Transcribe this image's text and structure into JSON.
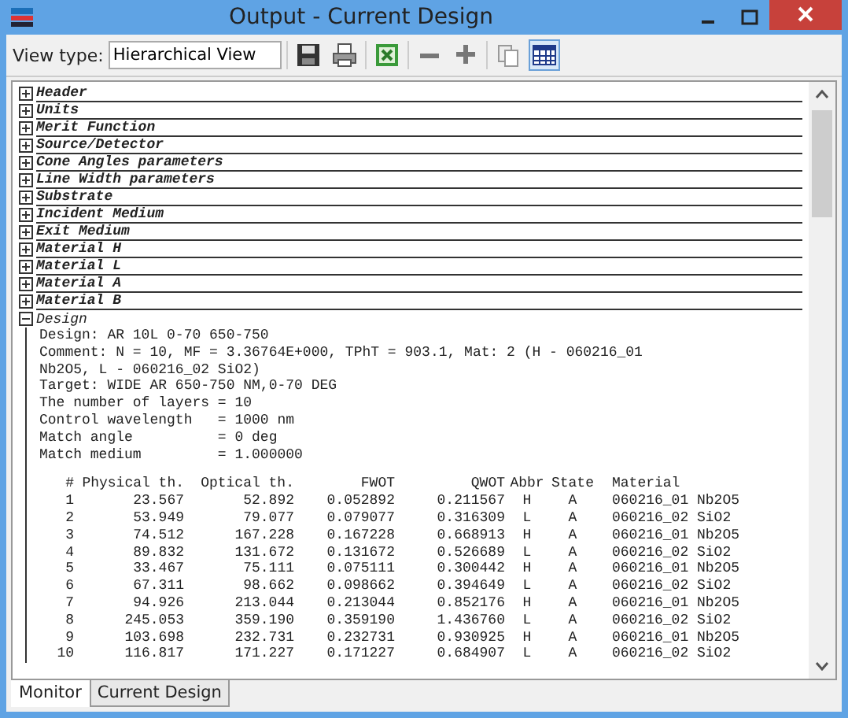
{
  "window": {
    "title": "Output - Current Design"
  },
  "toolbar": {
    "label": "View type:",
    "view_type": {
      "value": "Hierarchical View"
    },
    "buttons": [
      {
        "kind": "save",
        "selected": false
      },
      {
        "kind": "print",
        "selected": false
      },
      {
        "kind": "excel",
        "selected": false
      },
      {
        "kind": "collapse",
        "selected": false
      },
      {
        "kind": "expand",
        "selected": false
      },
      {
        "kind": "copy",
        "selected": false
      },
      {
        "kind": "table",
        "selected": true
      }
    ]
  },
  "tree": [
    {
      "label": "Header",
      "expanded": false
    },
    {
      "label": "Units",
      "expanded": false
    },
    {
      "label": "Merit Function",
      "expanded": false
    },
    {
      "label": "Source/Detector",
      "expanded": false
    },
    {
      "label": "Cone Angles parameters",
      "expanded": false
    },
    {
      "label": "Line Width parameters",
      "expanded": false
    },
    {
      "label": "Substrate",
      "expanded": false
    },
    {
      "label": "Incident Medium",
      "expanded": false
    },
    {
      "label": "Exit Medium",
      "expanded": false
    },
    {
      "label": "Material H",
      "expanded": false
    },
    {
      "label": "Material L",
      "expanded": false
    },
    {
      "label": "Material A",
      "expanded": false
    },
    {
      "label": "Material B",
      "expanded": false
    },
    {
      "label": "Design",
      "expanded": true,
      "lines": [
        "Design: AR 10L 0-70 650-750",
        "Comment: N = 10, MF = 3.36764E+000, TPhT = 903.1, Mat: 2 (H - 060216_01",
        "Nb2O5, L - 060216_02 SiO2)",
        "Target: WIDE AR 650-750 NM,0-70 DEG",
        "The number of layers = 10",
        "Control wavelength   = 1000 nm",
        "Match angle          = 0 deg",
        "Match medium         = 1.000000"
      ],
      "table": {
        "columns": [
          "#",
          "Physical th.",
          "Optical th.",
          "FWOT",
          "QWOT",
          "Abbr",
          "State",
          "Material"
        ],
        "rows": [
          [
            "1",
            "23.567",
            "52.892",
            "0.052892",
            "0.211567",
            "H",
            "A",
            "060216_01 Nb2O5"
          ],
          [
            "2",
            "53.949",
            "79.077",
            "0.079077",
            "0.316309",
            "L",
            "A",
            "060216_02 SiO2"
          ],
          [
            "3",
            "74.512",
            "167.228",
            "0.167228",
            "0.668913",
            "H",
            "A",
            "060216_01 Nb2O5"
          ],
          [
            "4",
            "89.832",
            "131.672",
            "0.131672",
            "0.526689",
            "L",
            "A",
            "060216_02 SiO2"
          ],
          [
            "5",
            "33.467",
            "75.111",
            "0.075111",
            "0.300442",
            "H",
            "A",
            "060216_01 Nb2O5"
          ],
          [
            "6",
            "67.311",
            "98.662",
            "0.098662",
            "0.394649",
            "L",
            "A",
            "060216_02 SiO2"
          ],
          [
            "7",
            "94.926",
            "213.044",
            "0.213044",
            "0.852176",
            "H",
            "A",
            "060216_01 Nb2O5"
          ],
          [
            "8",
            "245.053",
            "359.190",
            "0.359190",
            "1.436760",
            "L",
            "A",
            "060216_02 SiO2"
          ],
          [
            "9",
            "103.698",
            "232.731",
            "0.232731",
            "0.930925",
            "H",
            "A",
            "060216_01 Nb2O5"
          ],
          [
            "10",
            "116.817",
            "171.227",
            "0.171227",
            "0.684907",
            "L",
            "A",
            "060216_02 SiO2"
          ]
        ]
      }
    }
  ],
  "tabs": [
    {
      "label": "Monitor",
      "selected": true
    },
    {
      "label": "Current Design",
      "selected": false
    }
  ]
}
